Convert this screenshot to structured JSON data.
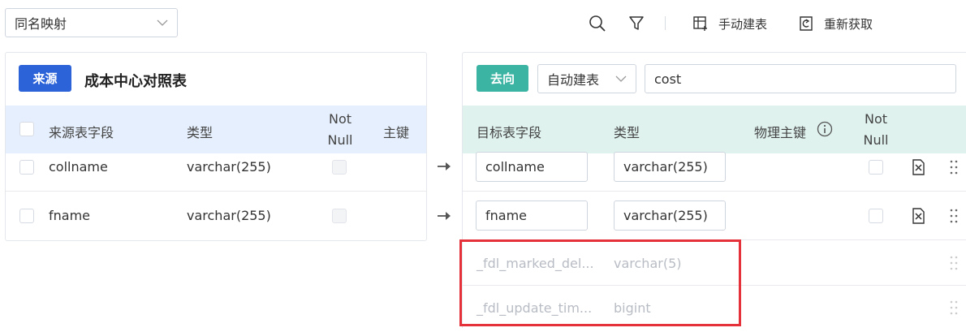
{
  "toolbar": {
    "mapping_select": "同名映射",
    "manual_build_label": "手动建表",
    "refetch_label": "重新获取"
  },
  "source": {
    "tag": "来源",
    "title": "成本中心对照表",
    "headers": {
      "field": "来源表字段",
      "type": "类型",
      "notnull_1": "Not",
      "notnull_2": "Null",
      "pk": "主键"
    },
    "rows": [
      {
        "name": "collname",
        "type": "varchar(255)"
      },
      {
        "name": "fname",
        "type": "varchar(255)"
      }
    ]
  },
  "target": {
    "tag": "去向",
    "mode_select": "自动建表",
    "table_name": "cost",
    "headers": {
      "field": "目标表字段",
      "type": "类型",
      "physical_pk": "物理主键",
      "notnull_1": "Not",
      "notnull_2": "Null"
    },
    "rows": [
      {
        "name": "collname",
        "type": "varchar(255)"
      },
      {
        "name": "fname",
        "type": "varchar(255)"
      }
    ],
    "system_rows": [
      {
        "name": "_fdl_marked_del...",
        "type": "varchar(5)"
      },
      {
        "name": "_fdl_update_tim...",
        "type": "bigint"
      }
    ]
  },
  "colors": {
    "source_tag": "#2d63d8",
    "target_tag": "#3cb4a4",
    "source_header_bg": "#e6effd",
    "target_header_bg": "#dff2ee",
    "highlight_border": "#e5313a"
  }
}
